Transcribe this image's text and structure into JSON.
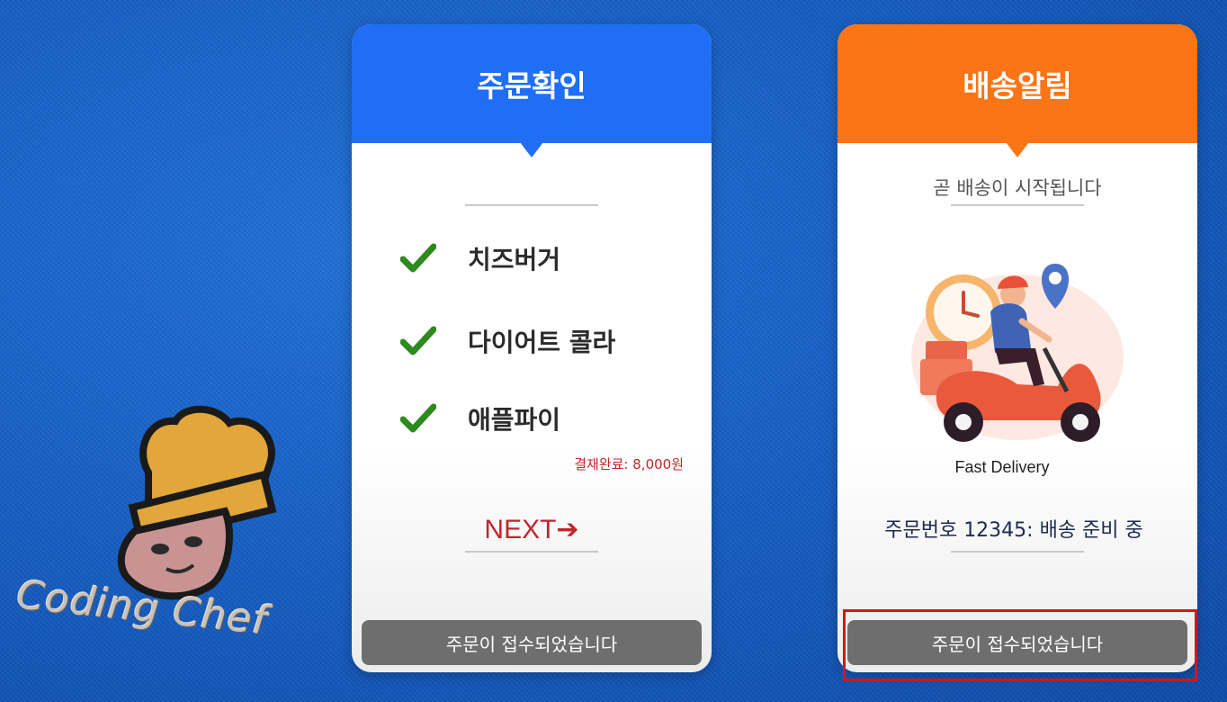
{
  "logo": {
    "text": "Coding Chef"
  },
  "order_card": {
    "title": "주문확인",
    "items": [
      {
        "label": "치즈버거"
      },
      {
        "label": "다이어트 콜라"
      },
      {
        "label": "애플파이"
      }
    ],
    "payment": "결재완료: 8,000원",
    "next_label": "NEXT➔",
    "button_label": "주문이 접수되었습니다"
  },
  "delivery_card": {
    "title": "배송알림",
    "subtitle": "곧 배송이 시작됩니다",
    "image_caption": "Fast Delivery",
    "order_status": "주문번호 12345: 배송 준비 중",
    "button_label": "주문이 접수되었습니다"
  },
  "colors": {
    "order_header": "#1f6ef5",
    "delivery_header": "#fb7416",
    "check": "#2e8a1e",
    "accent_red": "#c0262d",
    "button_gray": "#6e6e6e",
    "highlight_box": "#d01818"
  },
  "icons": [
    "check-icon",
    "chef-hat-logo",
    "delivery-scooter-illustration",
    "location-pin-icon",
    "clock-icon"
  ]
}
